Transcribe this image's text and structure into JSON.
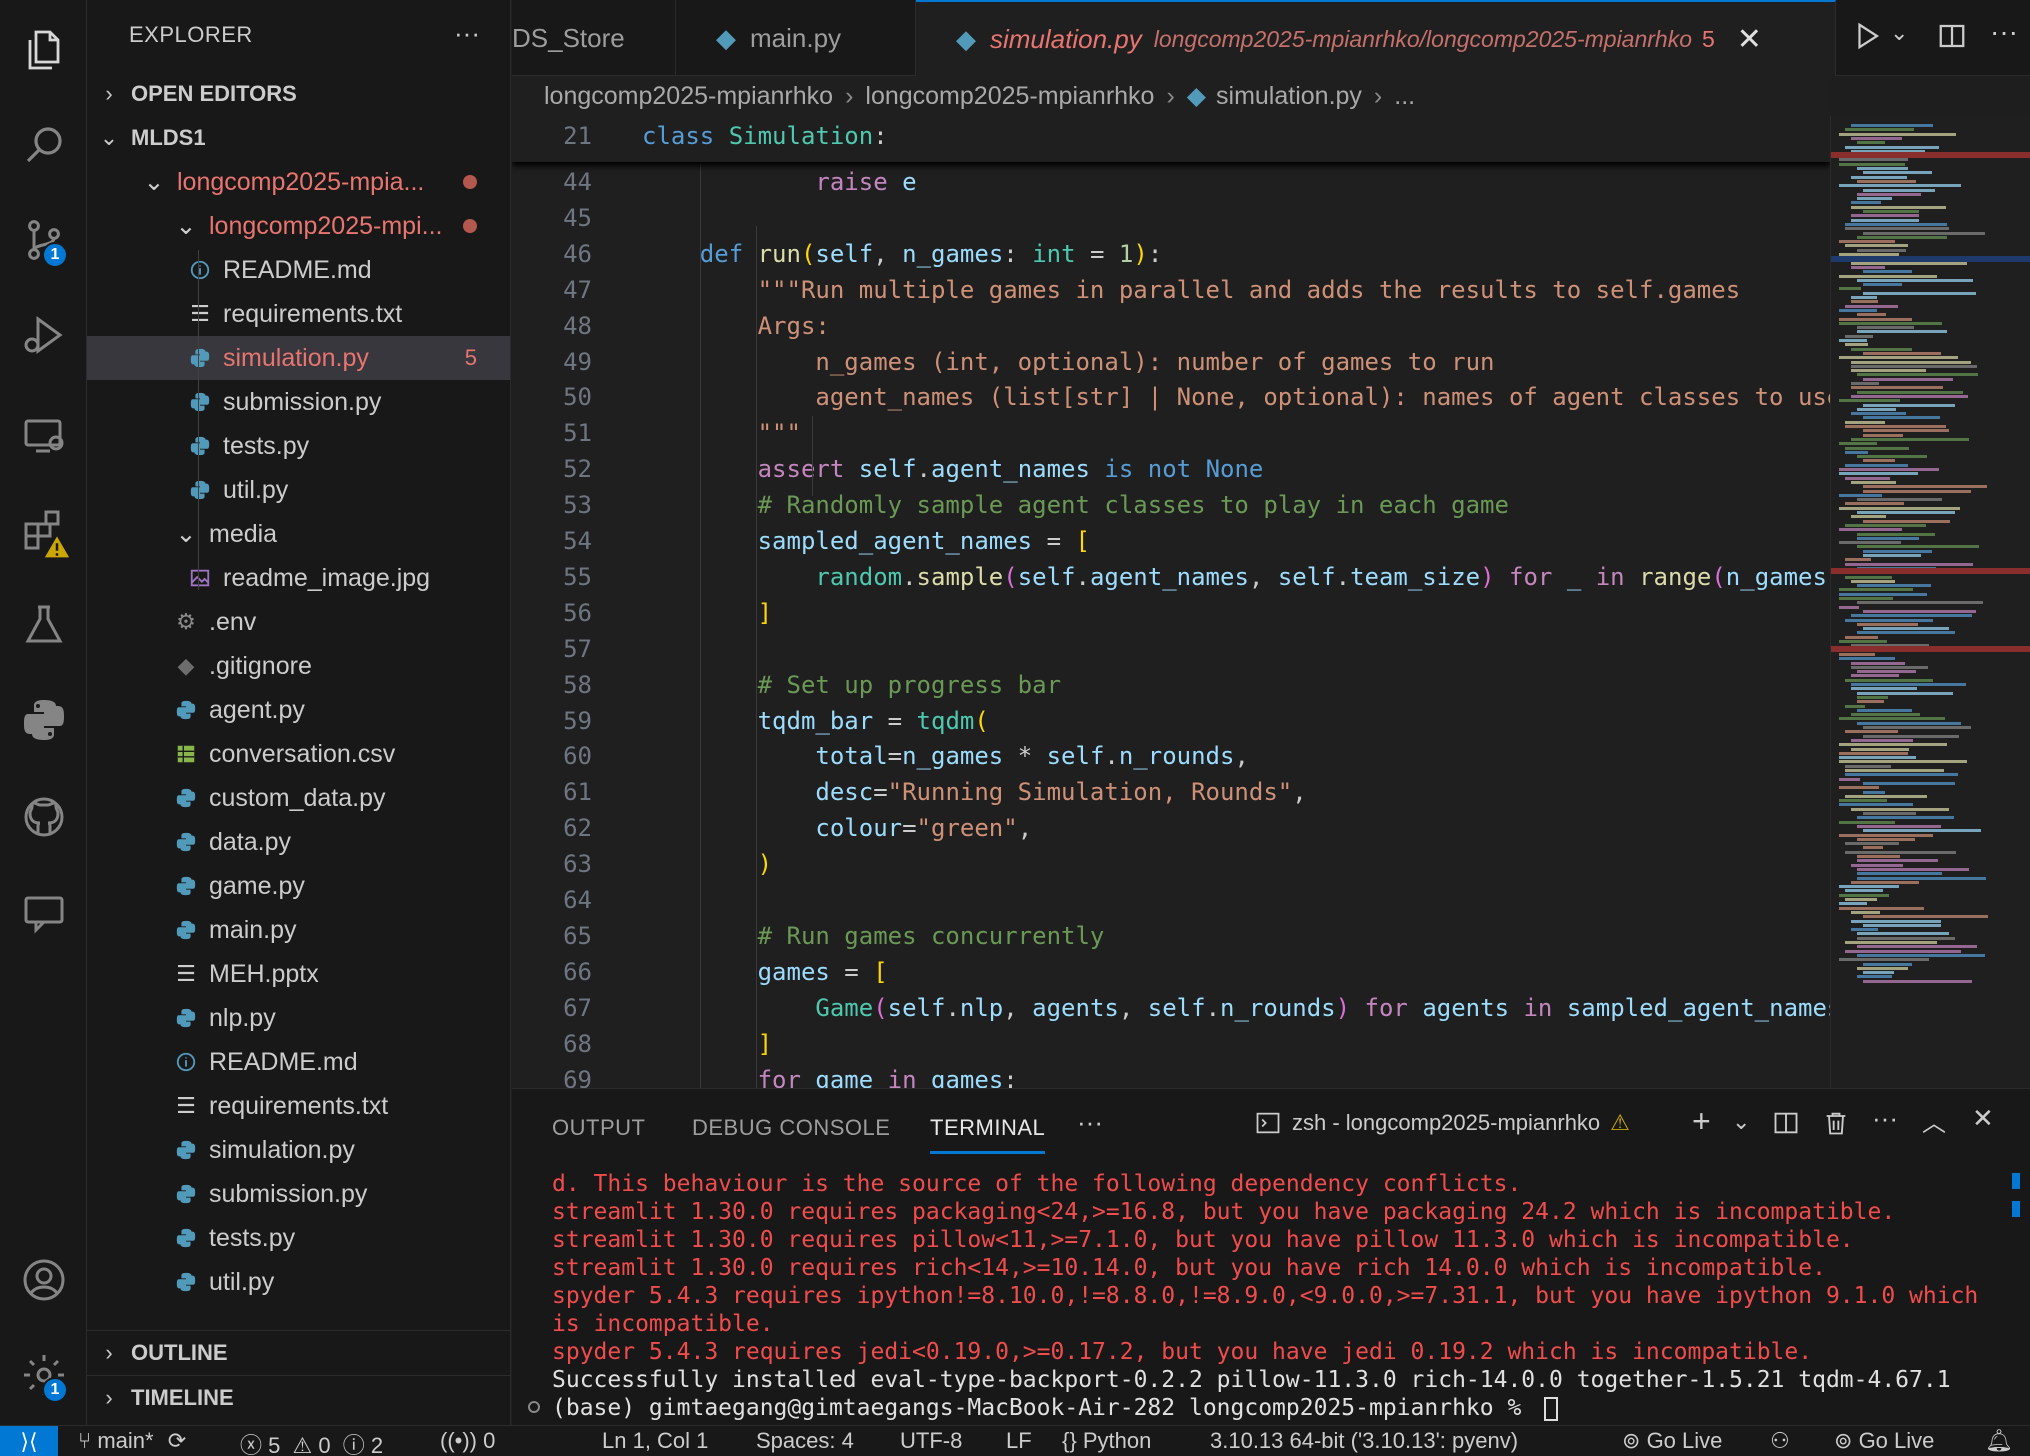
{
  "sidebar": {
    "title": "EXPLORER",
    "sections": {
      "open_editors": "OPEN EDITORS",
      "workspace": "MLDS1",
      "outline": "OUTLINE",
      "timeline": "TIMELINE"
    },
    "tree": [
      {
        "label": "longcomp2025-mpia...",
        "type": "folder-open",
        "git": "dot"
      },
      {
        "label": "longcomp2025-mpi...",
        "type": "folder-open",
        "git": "dot"
      },
      {
        "label": "README.md",
        "type": "info"
      },
      {
        "label": "requirements.txt",
        "type": "text"
      },
      {
        "label": "simulation.py",
        "type": "python",
        "count": "5"
      },
      {
        "label": "submission.py",
        "type": "python"
      },
      {
        "label": "tests.py",
        "type": "python"
      },
      {
        "label": "util.py",
        "type": "python"
      },
      {
        "label": "media",
        "type": "folder-open"
      },
      {
        "label": "readme_image.jpg",
        "type": "image"
      },
      {
        "label": ".env",
        "type": "gear"
      },
      {
        "label": ".gitignore",
        "type": "git"
      },
      {
        "label": "agent.py",
        "type": "python"
      },
      {
        "label": "conversation.csv",
        "type": "csv"
      },
      {
        "label": "custom_data.py",
        "type": "python"
      },
      {
        "label": "data.py",
        "type": "python"
      },
      {
        "label": "game.py",
        "type": "python"
      },
      {
        "label": "main.py",
        "type": "python"
      },
      {
        "label": "MEH.pptx",
        "type": "text"
      },
      {
        "label": "nlp.py",
        "type": "python"
      },
      {
        "label": "README.md",
        "type": "info"
      },
      {
        "label": "requirements.txt",
        "type": "text"
      },
      {
        "label": "simulation.py",
        "type": "python"
      },
      {
        "label": "submission.py",
        "type": "python"
      },
      {
        "label": "tests.py",
        "type": "python"
      },
      {
        "label": "util.py",
        "type": "python"
      }
    ]
  },
  "activity_badges": {
    "source_control": "1",
    "settings": "1"
  },
  "tabs": [
    {
      "label": "DS_Store"
    },
    {
      "label": "main.py"
    },
    {
      "label": "simulation.py",
      "path": "longcomp2025-mpianrhko/longcomp2025-mpianrhko",
      "problems": "5"
    }
  ],
  "breadcrumb": [
    "longcomp2025-mpianrhko",
    "longcomp2025-mpianrhko",
    "simulation.py",
    "..."
  ],
  "editor": {
    "sticky": {
      "line": "21",
      "text": "class Simulation:"
    },
    "lines": [
      {
        "n": "44",
        "indent": 2,
        "html": "            <span class=\"kw2\">raise</span> <span class=\"var\">e</span>"
      },
      {
        "n": "45",
        "html": ""
      },
      {
        "n": "46",
        "html": "    <span class=\"kw\">def</span> <span class=\"fn\">run</span><span class=\"par\">(</span><span class=\"var\">self</span>, <span class=\"var\">n_games</span>: <span class=\"cls\">int</span> = <span class=\"num\">1</span><span class=\"par\">)</span>:"
      },
      {
        "n": "47",
        "html": "        <span class=\"str\">\"\"\"Run multiple games in parallel and adds the results to self.games</span>"
      },
      {
        "n": "48",
        "html": "        <span class=\"str\">Args:</span>"
      },
      {
        "n": "49",
        "html": "            <span class=\"str\">n_games (int, optional): number of games to run</span>"
      },
      {
        "n": "50",
        "html": "            <span class=\"str\">agent_names (list[str] | None, optional): names of agent classes to use</span>"
      },
      {
        "n": "51",
        "html": "        <span class=\"str\">\"\"\"</span>"
      },
      {
        "n": "52",
        "html": "        <span class=\"kw2\">assert</span> <span class=\"var\">self</span>.<span class=\"var\">agent_names</span> <span class=\"kw\">is not</span> <span class=\"kw\">None</span>"
      },
      {
        "n": "53",
        "html": "        <span class=\"cmt\"># Randomly sample agent classes to play in each game</span>"
      },
      {
        "n": "54",
        "html": "        <span class=\"var\">sampled_agent_names</span> = <span class=\"par\">[</span>"
      },
      {
        "n": "55",
        "html": "            <span class=\"cls\">random</span>.<span class=\"fn\">sample</span><span class=\"par2\">(</span><span class=\"var\">self</span>.<span class=\"var\">agent_names</span>, <span class=\"var\">self</span>.<span class=\"var\">team_size</span><span class=\"par2\">)</span> <span class=\"kw2\">for</span> <span class=\"var\">_</span> <span class=\"kw2\">in</span> <span class=\"fn\">range</span><span class=\"par2\">(</span><span class=\"var\">n_games</span><span class=\"par2\">)</span>"
      },
      {
        "n": "56",
        "html": "        <span class=\"par\">]</span>"
      },
      {
        "n": "57",
        "html": ""
      },
      {
        "n": "58",
        "html": "        <span class=\"cmt\"># Set up progress bar</span>"
      },
      {
        "n": "59",
        "html": "        <span class=\"var\">tqdm_bar</span> = <span class=\"cls\">tqdm</span><span class=\"par\">(</span>"
      },
      {
        "n": "60",
        "html": "            <span class=\"var\">total</span>=<span class=\"var\">n_games</span> * <span class=\"var\">self</span>.<span class=\"var\">n_rounds</span>,"
      },
      {
        "n": "61",
        "html": "            <span class=\"var\">desc</span>=<span class=\"str\">\"Running Simulation, Rounds\"</span>,"
      },
      {
        "n": "62",
        "html": "            <span class=\"var\">colour</span>=<span class=\"str\">\"green\"</span>,"
      },
      {
        "n": "63",
        "html": "        <span class=\"par\">)</span>"
      },
      {
        "n": "64",
        "html": ""
      },
      {
        "n": "65",
        "html": "        <span class=\"cmt\"># Run games concurrently</span>"
      },
      {
        "n": "66",
        "html": "        <span class=\"var\">games</span> = <span class=\"par\">[</span>"
      },
      {
        "n": "67",
        "html": "            <span class=\"cls\">Game</span><span class=\"par2\">(</span><span class=\"var\">self</span>.<span class=\"var\">nlp</span>, <span class=\"var\">agents</span>, <span class=\"var\">self</span>.<span class=\"var\">n_rounds</span><span class=\"par2\">)</span> <span class=\"kw2\">for</span> <span class=\"var\">agents</span> <span class=\"kw2\">in</span> <span class=\"var\">sampled_agent_names</span>"
      },
      {
        "n": "68",
        "html": "        <span class=\"par\">]</span>"
      },
      {
        "n": "69",
        "html": "        <span class=\"kw2\">for</span> <span class=\"var\">game</span> <span class=\"kw2\">in</span> <span class=\"var\">games</span>:"
      }
    ]
  },
  "panel": {
    "tabs": [
      "OUTPUT",
      "DEBUG CONSOLE",
      "TERMINAL"
    ],
    "active_tab": "TERMINAL",
    "terminal_name": "zsh - longcomp2025-mpianrhko",
    "lines": [
      {
        "kind": "err",
        "text": "d. This behaviour is the source of the following dependency conflicts."
      },
      {
        "kind": "err",
        "text": "streamlit 1.30.0 requires packaging<24,>=16.8, but you have packaging 24.2 which is incompatible."
      },
      {
        "kind": "err",
        "text": "streamlit 1.30.0 requires pillow<11,>=7.1.0, but you have pillow 11.3.0 which is incompatible."
      },
      {
        "kind": "err",
        "text": "streamlit 1.30.0 requires rich<14,>=10.14.0, but you have rich 14.0.0 which is incompatible."
      },
      {
        "kind": "err",
        "text": "spyder 5.4.3 requires ipython!=8.10.0,!=8.8.0,!=8.9.0,<9.0.0,>=7.31.1, but you have ipython 9.1.0 which"
      },
      {
        "kind": "err",
        "text": "is incompatible."
      },
      {
        "kind": "err",
        "text": "spyder 5.4.3 requires jedi<0.19.0,>=0.17.2, but you have jedi 0.19.2 which is incompatible."
      },
      {
        "kind": "ok",
        "text": "Successfully installed eval-type-backport-0.2.2 pillow-11.3.0 rich-14.0.0 together-1.5.21 tqdm-4.67.1"
      },
      {
        "kind": "ok",
        "text": "(base) gimtaegang@gimtaegangs-MacBook-Air-282 longcomp2025-mpianrhko % "
      }
    ]
  },
  "status": {
    "branch": "main*",
    "errors": "5",
    "warnings": "0",
    "infos": "2",
    "ports": "0",
    "position": "Ln 1, Col 1",
    "spaces": "Spaces: 4",
    "encoding": "UTF-8",
    "eol": "LF",
    "language": "Python",
    "interpreter": "3.10.13 64-bit ('3.10.13': pyenv)",
    "golive1": "Go Live",
    "golive2": "Go Live"
  },
  "colors": {
    "accent": "#0078d4",
    "error": "#f14c4c",
    "modified": "#e8756f"
  }
}
